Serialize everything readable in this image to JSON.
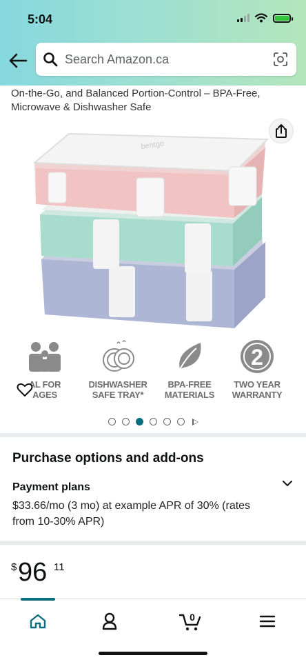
{
  "status_bar": {
    "time": "5:04"
  },
  "search": {
    "placeholder": "Search Amazon.ca"
  },
  "product": {
    "title_fragment": "On-the-Go, and Balanced Portion-Control – BPA-Free, Microwave & Dishwasher Safe",
    "brand_on_lid": "bentgo",
    "image_count": 6,
    "active_image_index": 3
  },
  "badges": [
    {
      "icon": "family-icon",
      "line1": "AL FOR",
      "line2": "AGES"
    },
    {
      "icon": "dishwasher-icon",
      "line1": "DISHWASHER",
      "line2": "SAFE TRAY*"
    },
    {
      "icon": "leaf-icon",
      "line1": "BPA-FREE",
      "line2": "MATERIALS"
    },
    {
      "icon": "two-badge-icon",
      "number": "2",
      "line1": "TWO YEAR",
      "line2": "WARRANTY"
    }
  ],
  "purchase": {
    "title": "Purchase options and add-ons",
    "payment_label": "Payment plans",
    "payment_text": "$33.66/mo (3 mo) at example APR of 30% (rates from 10-30% APR)"
  },
  "price": {
    "currency": "$",
    "whole": "96",
    "cents": "11"
  },
  "nav": {
    "cart_count": "0",
    "tabs": [
      "home-icon",
      "account-icon",
      "cart-icon",
      "menu-icon"
    ]
  },
  "colors": {
    "accent": "#0a6f7c",
    "header_start": "#86d8de",
    "header_end": "#b3e6bb",
    "badge_grey": "#6e6e6e"
  }
}
